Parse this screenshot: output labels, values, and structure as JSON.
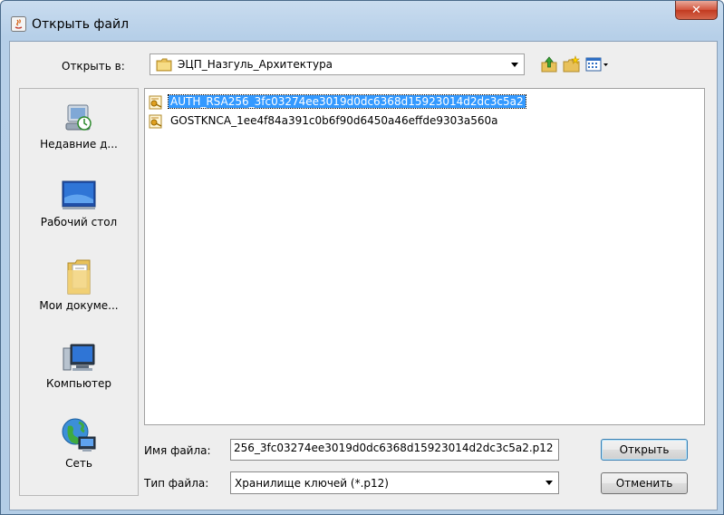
{
  "window": {
    "title": "Открыть файл"
  },
  "toolbar": {
    "look_in_label": "Открыть в:",
    "look_in_value": "ЭЦП_Назгуль_Архитектура",
    "icons": [
      "up-folder-icon",
      "new-folder-icon",
      "view-menu-icon"
    ]
  },
  "places": [
    {
      "label": "Недавние д...",
      "icon": "recent-icon"
    },
    {
      "label": "Рабочий стол",
      "icon": "desktop-icon"
    },
    {
      "label": "Мои докуме...",
      "icon": "documents-icon"
    },
    {
      "label": "Компьютер",
      "icon": "computer-icon"
    },
    {
      "label": "Сеть",
      "icon": "network-icon"
    }
  ],
  "files": [
    {
      "name": "AUTH_RSA256_3fc03274ee3019d0dc6368d15923014d2dc3c5a2",
      "selected": true
    },
    {
      "name": "GOSTKNCA_1ee4f84a391c0b6f90d6450a46effde9303a560a",
      "selected": false
    }
  ],
  "form": {
    "filename_label": "Имя файла:",
    "filename_value": "256_3fc03274ee3019d0dc6368d15923014d2dc3c5a2.p12",
    "filetype_label": "Тип файла:",
    "filetype_value": "Хранилище ключей (*.p12)"
  },
  "buttons": {
    "open": "Открыть",
    "cancel": "Отменить"
  }
}
